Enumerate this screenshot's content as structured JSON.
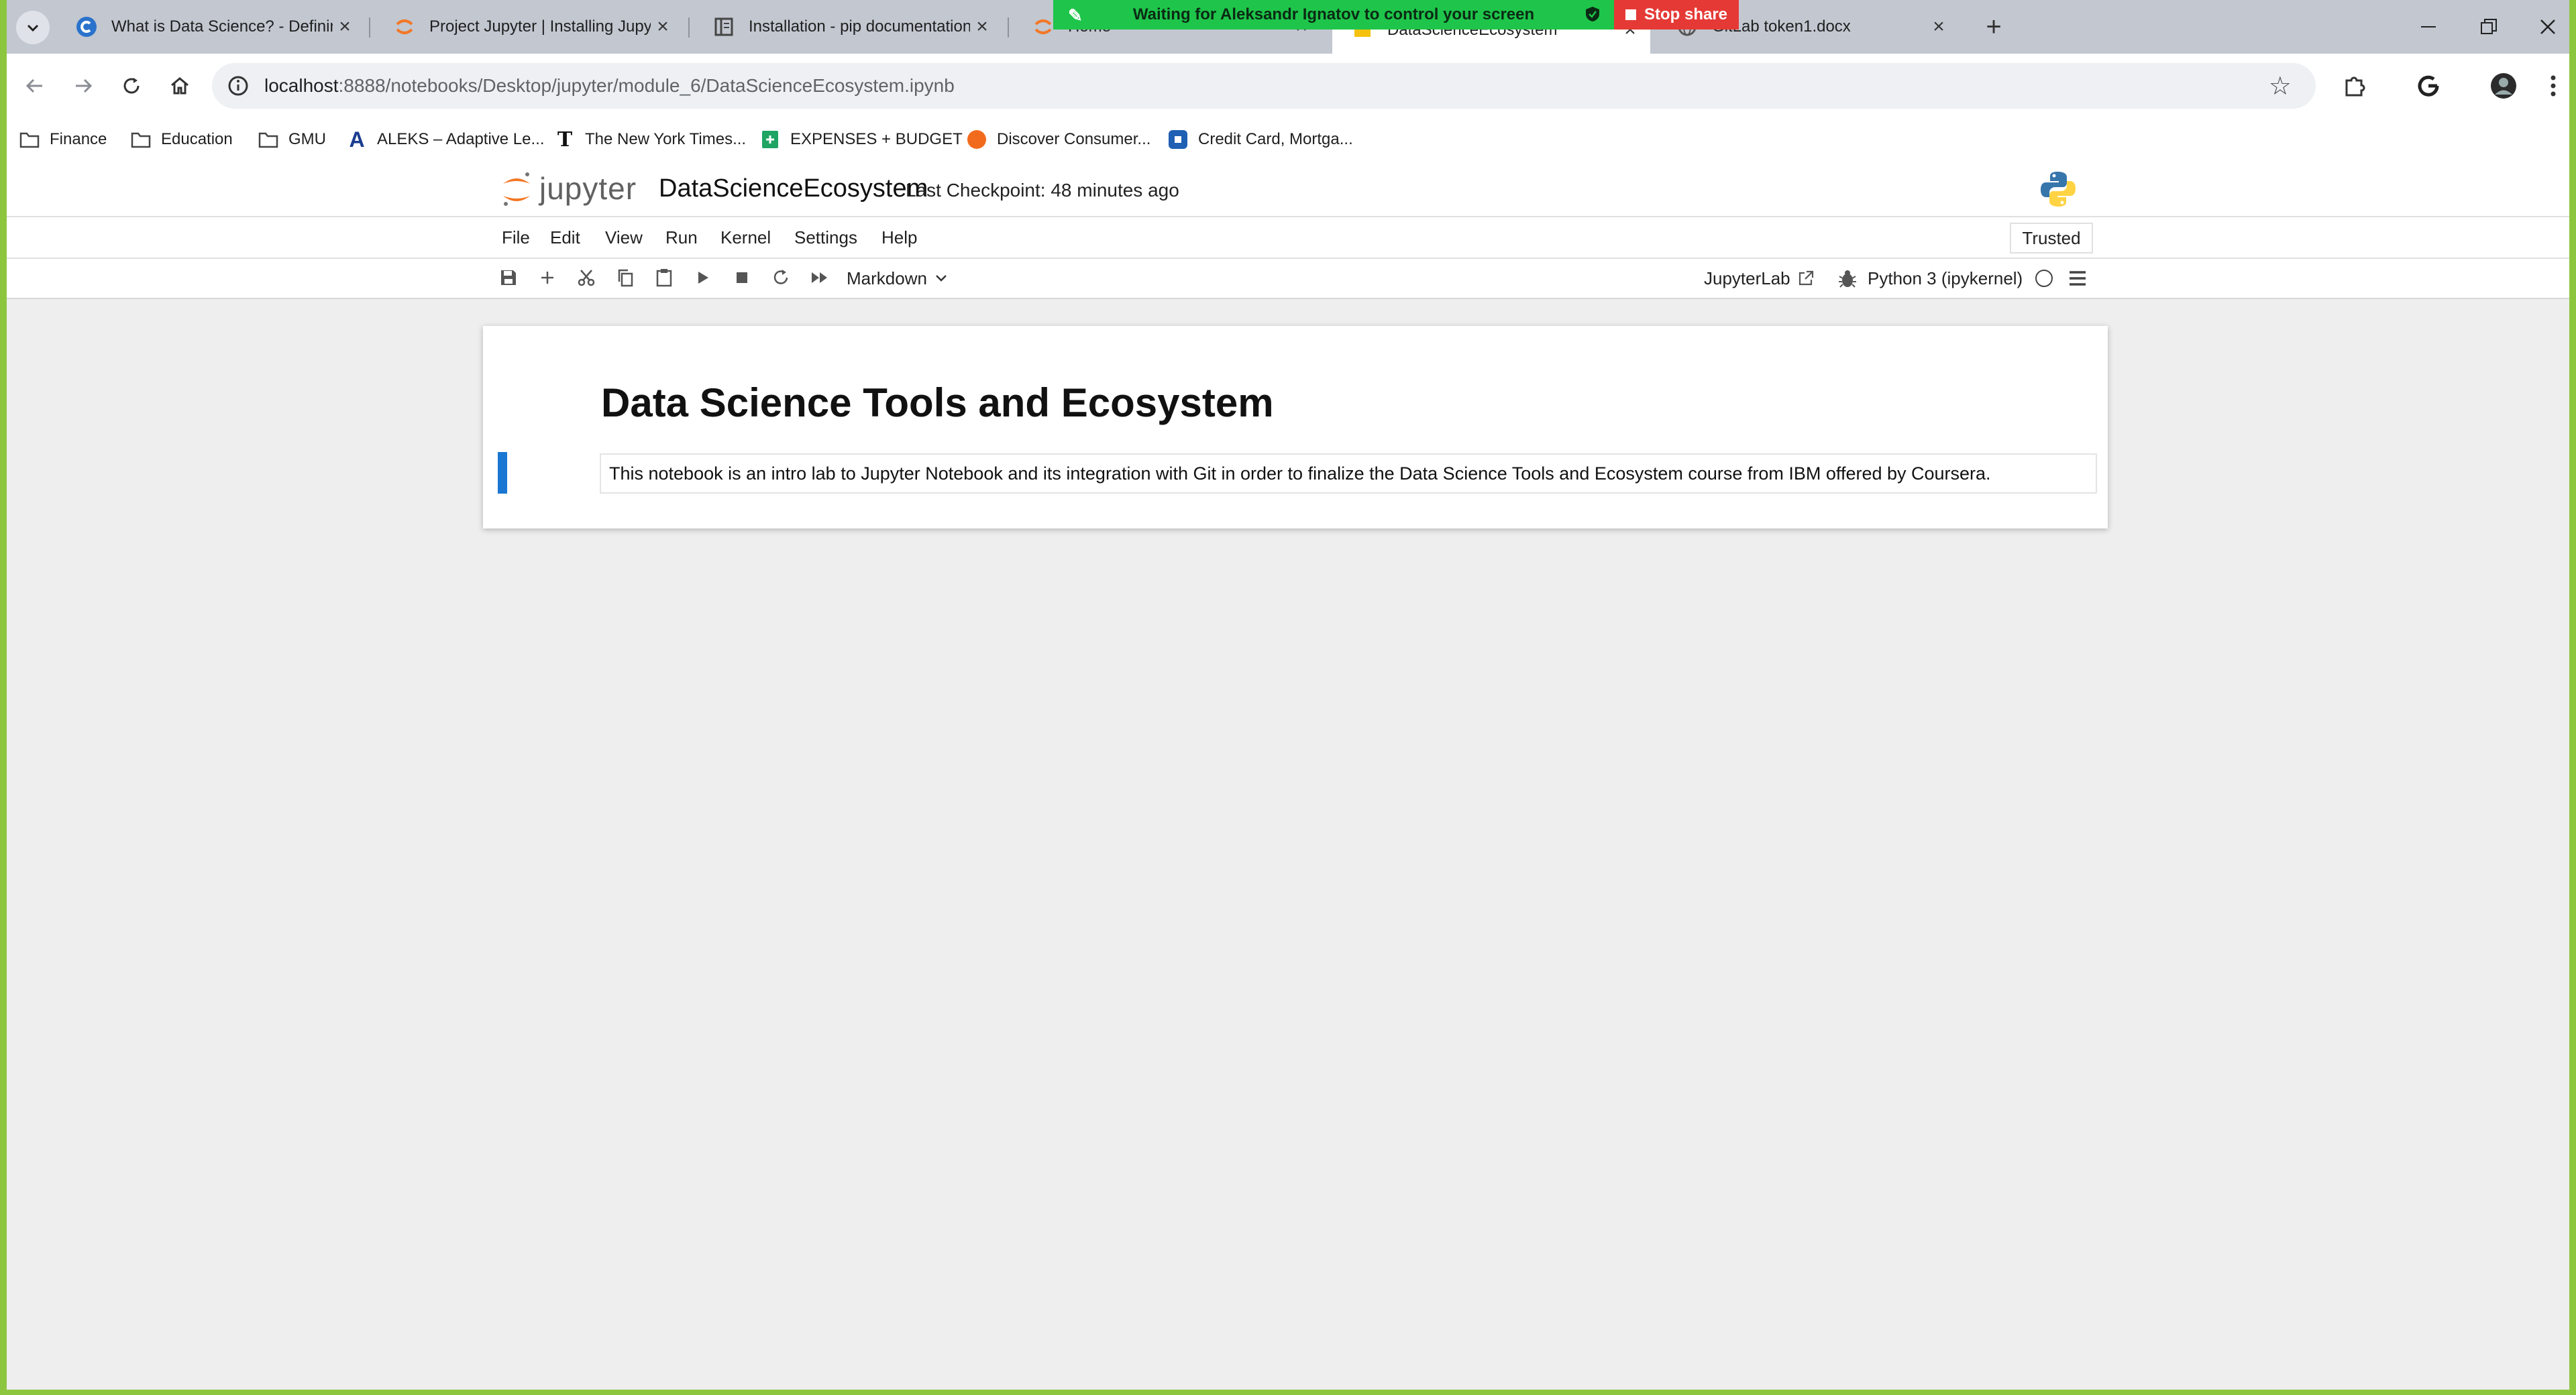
{
  "browser": {
    "tabs": [
      {
        "title": "What is Data Science? - Defining",
        "active": false
      },
      {
        "title": "Project Jupyter | Installing Jupyt",
        "active": false
      },
      {
        "title": "Installation - pip documentation",
        "active": false
      },
      {
        "title": "Home",
        "active": false
      },
      {
        "title": "DataScienceEcosystem",
        "active": true
      },
      {
        "title": "GitLab token1.docx",
        "active": false
      }
    ],
    "url_host": "localhost",
    "url_rest": ":8888/notebooks/Desktop/jupyter/module_6/DataScienceEcosystem.ipynb",
    "bookmarks": [
      {
        "label": "Finance",
        "icon": "folder-icon"
      },
      {
        "label": "Education",
        "icon": "folder-icon"
      },
      {
        "label": "GMU",
        "icon": "folder-icon"
      },
      {
        "label": "ALEKS – Adaptive Le...",
        "icon": "aleks-icon"
      },
      {
        "label": "The New York Times...",
        "icon": "nyt-icon"
      },
      {
        "label": "EXPENSES + BUDGET",
        "icon": "sheets-icon"
      },
      {
        "label": "Discover Consumer...",
        "icon": "discover-icon"
      },
      {
        "label": "Credit Card, Mortga...",
        "icon": "chase-icon"
      }
    ]
  },
  "screen_share": {
    "message": "Waiting for Aleksandr Ignatov to control your screen",
    "stop_label": "Stop share"
  },
  "jupyter": {
    "logo_text": "jupyter",
    "notebook_title": "DataScienceEcosystem",
    "checkpoint": "Last Checkpoint: 48 minutes ago",
    "menu": [
      "File",
      "Edit",
      "View",
      "Run",
      "Kernel",
      "Settings",
      "Help"
    ],
    "trusted": "Trusted",
    "cell_type": "Markdown",
    "jupyterlab_link": "JupyterLab",
    "kernel": "Python 3 (ipykernel)"
  },
  "notebook": {
    "heading": "Data Science Tools and Ecosystem",
    "paragraph": "This notebook is an intro lab to Jupyter Notebook and its integration with Git in order to finalize the Data Science Tools and Ecosystem course from IBM offered by Coursera."
  },
  "colors": {
    "desktop_border": "#8cc63f",
    "share_banner": "#1ec54a",
    "stop_share": "#e53935",
    "cell_selection": "#1976d2",
    "jupyter_orange": "#f37726"
  }
}
